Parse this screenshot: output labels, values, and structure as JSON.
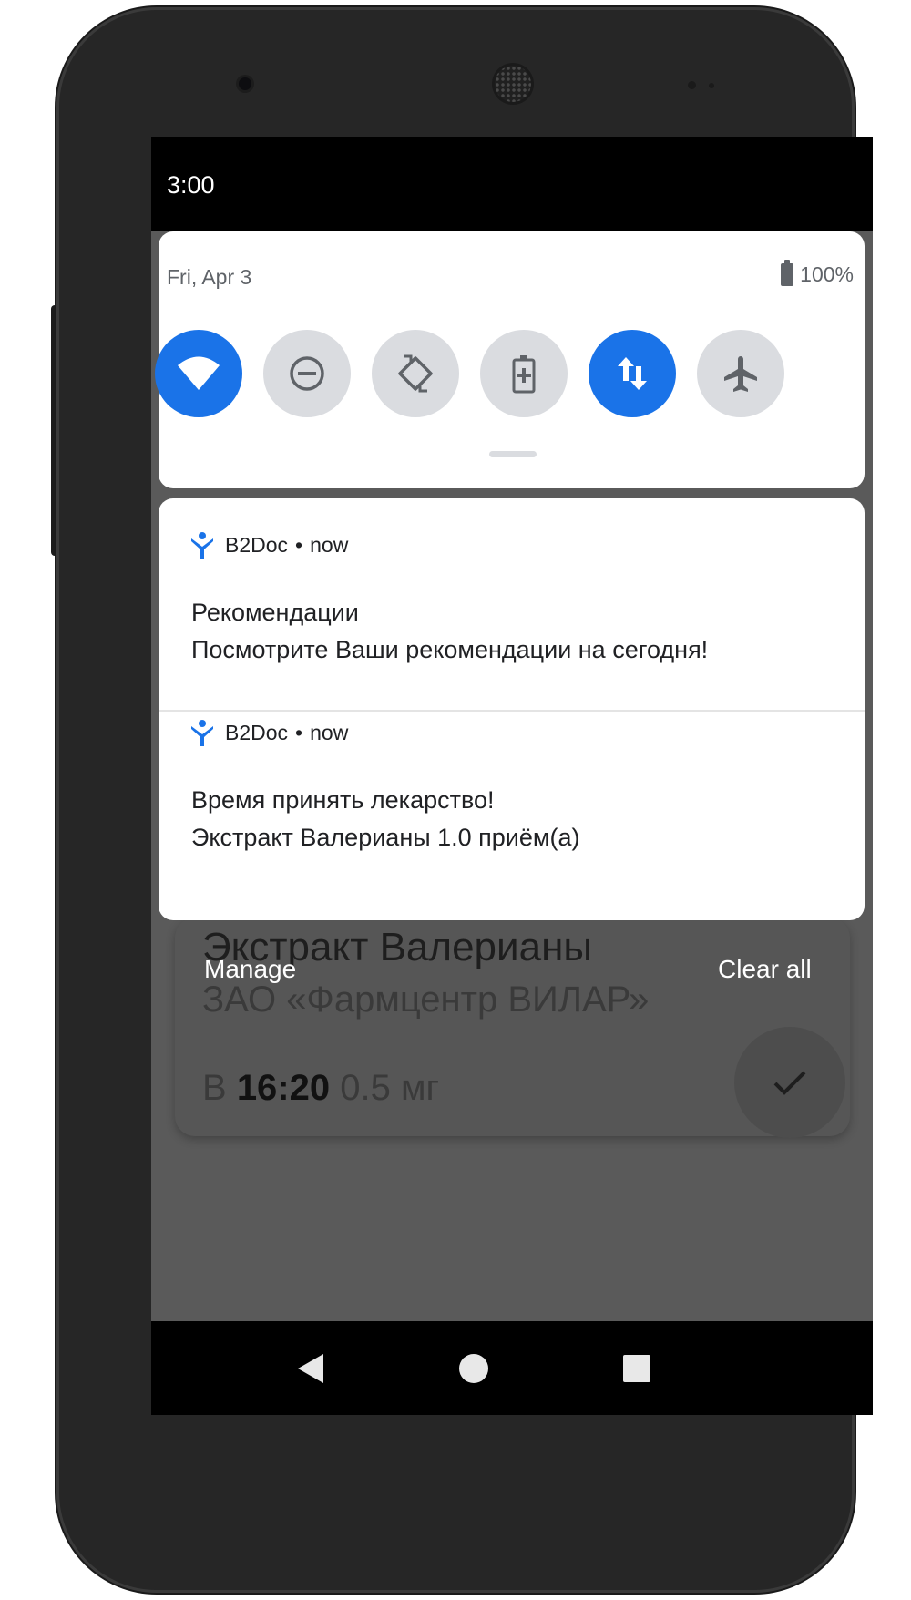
{
  "status_bar": {
    "time": "3:00"
  },
  "quick_settings": {
    "date": "Fri, Apr 3",
    "battery": "100%",
    "tiles": [
      {
        "name": "wifi",
        "icon": "wifi-icon",
        "active": true
      },
      {
        "name": "do-not-disturb",
        "icon": "do-not-disturb-icon",
        "active": false
      },
      {
        "name": "auto-rotate",
        "icon": "auto-rotate-icon",
        "active": false
      },
      {
        "name": "battery-saver",
        "icon": "battery-saver-icon",
        "active": false
      },
      {
        "name": "mobile-data",
        "icon": "mobile-data-icon",
        "active": true
      },
      {
        "name": "airplane-mode",
        "icon": "airplane-icon",
        "active": false
      }
    ],
    "accent_color": "#1a73e8"
  },
  "notifications": [
    {
      "app": "B2Doc",
      "separator": "•",
      "time": "now",
      "title": "Рекомендации",
      "text": "Посмотрите Ваши рекомендации на сегодня!"
    },
    {
      "app": "B2Doc",
      "separator": "•",
      "time": "now",
      "title": "Время принять лекарство!",
      "text": "Экстракт Валерианы 1.0 приём(а)"
    }
  ],
  "shade_actions": {
    "manage": "Manage",
    "clear_all": "Clear all"
  },
  "background_app": {
    "title": "Экстракт Валерианы",
    "subtitle": "ЗАО «Фармцентр ВИЛАР»",
    "dose_prefix": "В",
    "dose_time": "16:20",
    "dose_amount": "0.5 мг"
  },
  "nav_bar": {
    "back": "back-icon",
    "home": "home-icon",
    "recents": "recents-icon"
  }
}
